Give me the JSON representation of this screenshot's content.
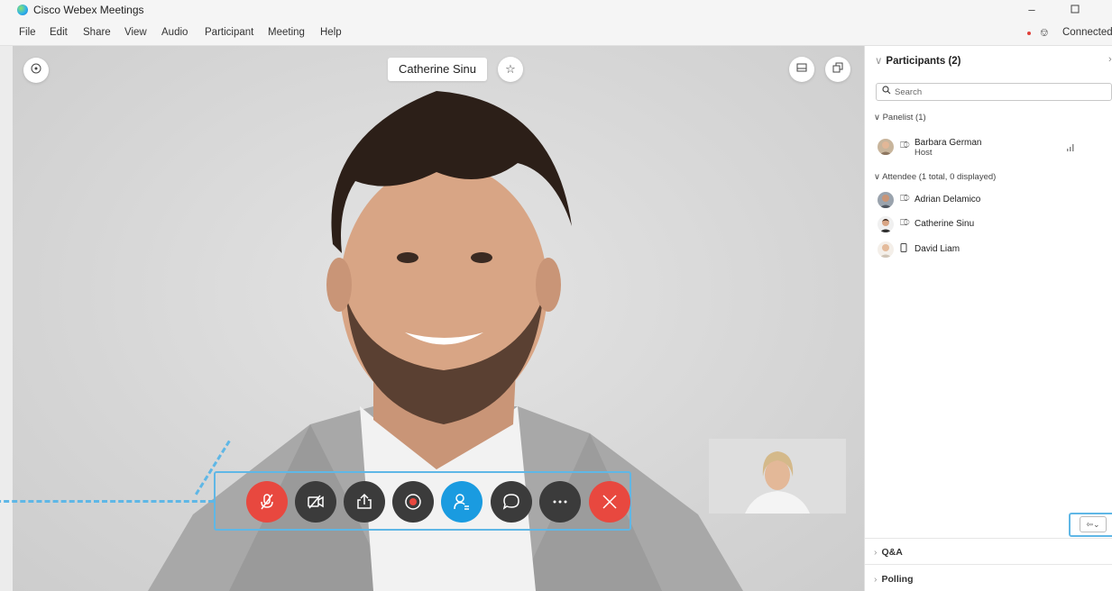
{
  "window": {
    "title": "Cisco Webex Meetings",
    "minimize_icon": "minimize-icon",
    "maximize_icon": "maximize-icon"
  },
  "menu": [
    "File",
    "Edit",
    "Share",
    "View",
    "Audio",
    "Participant",
    "Meeting",
    "Help"
  ],
  "connection": {
    "status": "Connected"
  },
  "stage": {
    "active_speaker_name": "Catherine Sinu",
    "info_icon": "info-icon",
    "pin_icon": "pin-icon",
    "layout_icon": "layout-icon",
    "popout_icon": "popout-icon"
  },
  "controls": [
    {
      "id": "mute",
      "icon": "microphone-muted-icon",
      "color": "#e8483f"
    },
    {
      "id": "video",
      "icon": "video-off-icon",
      "color": "#3b3b3b"
    },
    {
      "id": "share",
      "icon": "share-icon",
      "color": "#3b3b3b"
    },
    {
      "id": "record",
      "icon": "record-icon",
      "color": "#3b3b3b"
    },
    {
      "id": "participants",
      "icon": "participants-icon",
      "color": "#1a9be0"
    },
    {
      "id": "chat",
      "icon": "chat-icon",
      "color": "#3b3b3b"
    },
    {
      "id": "more",
      "icon": "more-icon",
      "color": "#3b3b3b"
    },
    {
      "id": "end",
      "icon": "close-icon",
      "color": "#e8483f"
    }
  ],
  "participants_panel": {
    "title": "Participants (2)",
    "search_placeholder": "Search",
    "panelist_section": "Panelist (1)",
    "panelists": [
      {
        "name": "Barbara German",
        "role": "Host"
      }
    ],
    "attendee_section": "Attendee (1 total, 0 displayed)",
    "attendees": [
      {
        "name": "Adrian Delamico"
      },
      {
        "name": "Catherine Sinu"
      },
      {
        "name": "David Liam"
      }
    ]
  },
  "bottom_sections": [
    "Q&A",
    "Polling"
  ],
  "colors": {
    "accent": "#1a9be0",
    "danger": "#e8483f",
    "highlight": "#5fb7e6"
  }
}
